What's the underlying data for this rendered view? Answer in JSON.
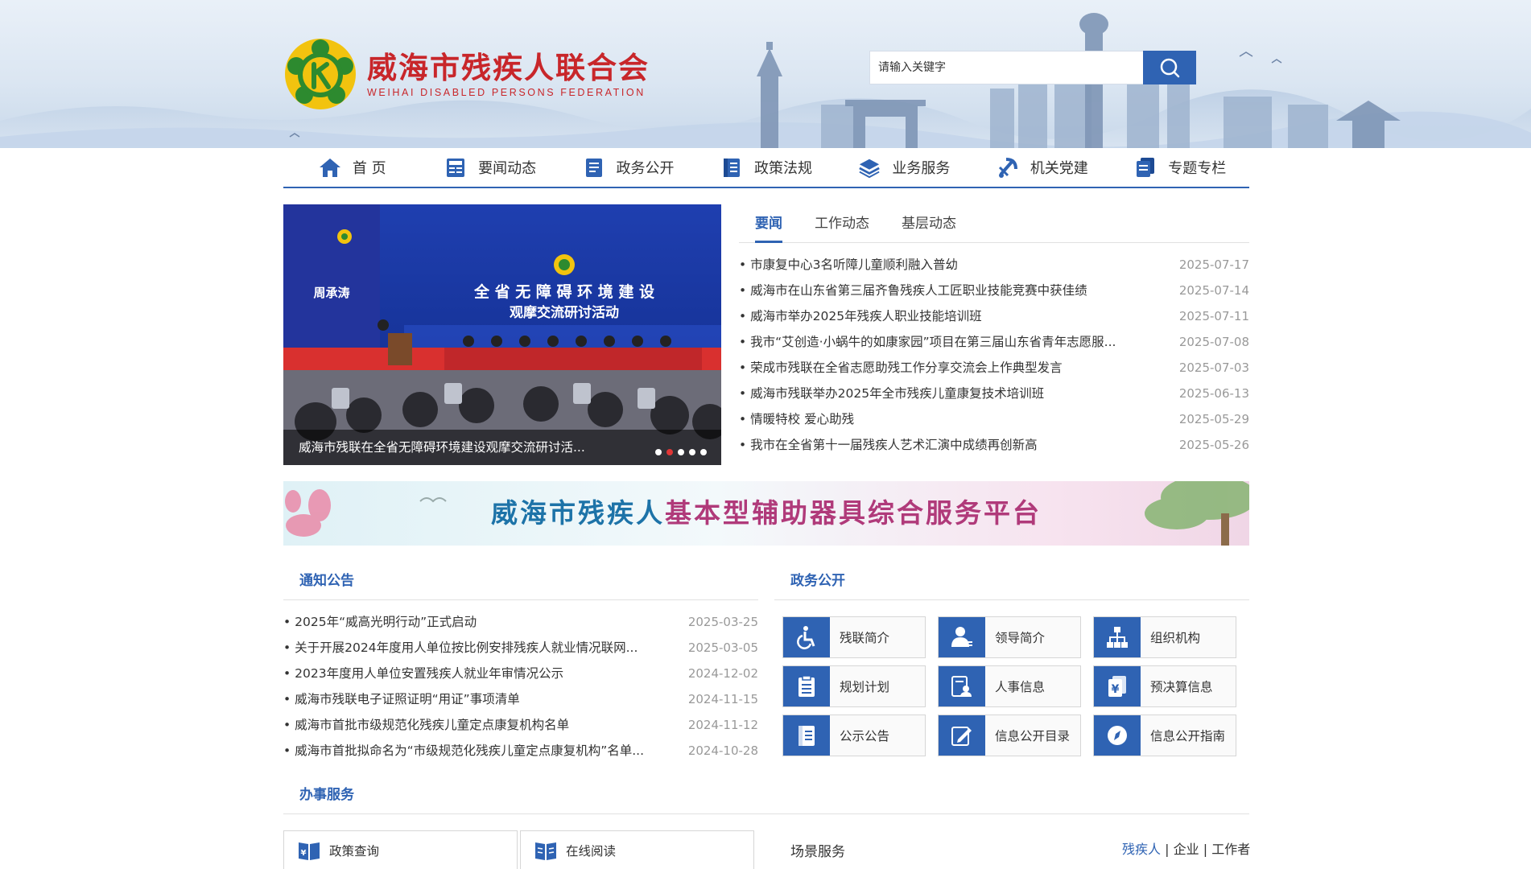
{
  "header": {
    "title": "威海市残疾人联合会",
    "subtitle": "WEIHAI DISABLED PERSONS FEDERATION",
    "search_placeholder": "请输入关键字"
  },
  "nav": {
    "items": [
      {
        "label": "首 页",
        "icon": "home-icon"
      },
      {
        "label": "要闻动态",
        "icon": "news-icon"
      },
      {
        "label": "政务公开",
        "icon": "document-icon"
      },
      {
        "label": "政策法规",
        "icon": "book-icon"
      },
      {
        "label": "业务服务",
        "icon": "layers-icon"
      },
      {
        "label": "机关党建",
        "icon": "party-icon"
      },
      {
        "label": "专题专栏",
        "icon": "copy-icon"
      }
    ]
  },
  "carousel": {
    "caption": "威海市残联在全省无障碍环境建设观摩交流研讨活...",
    "slide_heading_1": "全 省 无 障 碍 环 境 建 设",
    "slide_heading_2": "观摩交流研讨活动",
    "slide_speaker": "周承涛",
    "slide_count": 5,
    "active_slide": 2
  },
  "news": {
    "tabs": [
      "要闻",
      "工作动态",
      "基层动态"
    ],
    "active_tab": 0,
    "items": [
      {
        "title": "市康复中心3名听障儿童顺利融入普幼",
        "date": "2025-07-17"
      },
      {
        "title": "威海市在山东省第三届齐鲁残疾人工匠职业技能竞赛中获佳绩",
        "date": "2025-07-14"
      },
      {
        "title": "威海市举办2025年残疾人职业技能培训班",
        "date": "2025-07-11"
      },
      {
        "title": "我市“艾创造·小蜗牛的如康家园”项目在第三届山东省青年志愿服...",
        "date": "2025-07-08"
      },
      {
        "title": "荣成市残联在全省志愿助残工作分享交流会上作典型发言",
        "date": "2025-07-03"
      },
      {
        "title": "威海市残联举办2025年全市残疾儿童康复技术培训班",
        "date": "2025-06-13"
      },
      {
        "title": "情暖特校 爱心助残",
        "date": "2025-05-29"
      },
      {
        "title": "我市在全省第十一届残疾人艺术汇演中成绩再创新高",
        "date": "2025-05-26"
      }
    ]
  },
  "banner": {
    "title_part1": "威海市残疾人",
    "title_part2": "基本型辅助器具综合服务平台"
  },
  "notices": {
    "title": "通知公告",
    "items": [
      {
        "title": "2025年“威高光明行动”正式启动",
        "date": "2025-03-25"
      },
      {
        "title": "关于开展2024年度用人单位按比例安排残疾人就业情况联网...",
        "date": "2025-03-05"
      },
      {
        "title": "2023年度用人单位安置残疾人就业年审情况公示",
        "date": "2024-12-02"
      },
      {
        "title": "威海市残联电子证照证明“用证”事项清单",
        "date": "2024-11-15"
      },
      {
        "title": "威海市首批市级规范化残疾儿童定点康复机构名单",
        "date": "2024-11-12"
      },
      {
        "title": "威海市首批拟命名为“市级规范化残疾儿童定点康复机构”名单...",
        "date": "2024-10-28"
      }
    ]
  },
  "gov": {
    "title": "政务公开",
    "items": [
      {
        "label": "残联简介",
        "icon": "wheelchair-icon"
      },
      {
        "label": "领导简介",
        "icon": "leader-icon"
      },
      {
        "label": "组织机构",
        "icon": "org-chart-icon"
      },
      {
        "label": "规划计划",
        "icon": "clipboard-icon"
      },
      {
        "label": "人事信息",
        "icon": "personnel-icon"
      },
      {
        "label": "预决算信息",
        "icon": "budget-icon"
      },
      {
        "label": "公示公告",
        "icon": "announcement-icon"
      },
      {
        "label": "信息公开目录",
        "icon": "edit-icon"
      },
      {
        "label": "信息公开指南",
        "icon": "compass-icon"
      }
    ]
  },
  "services": {
    "title": "办事服务",
    "policy_query": "政策查询",
    "online_reading": "在线阅读",
    "scene_title": "场景服务",
    "scene_links": [
      "残疾人",
      "企业",
      "工作者"
    ],
    "separator": "|"
  },
  "colors": {
    "primary": "#2f63b3",
    "brand_red": "#c8262a"
  }
}
